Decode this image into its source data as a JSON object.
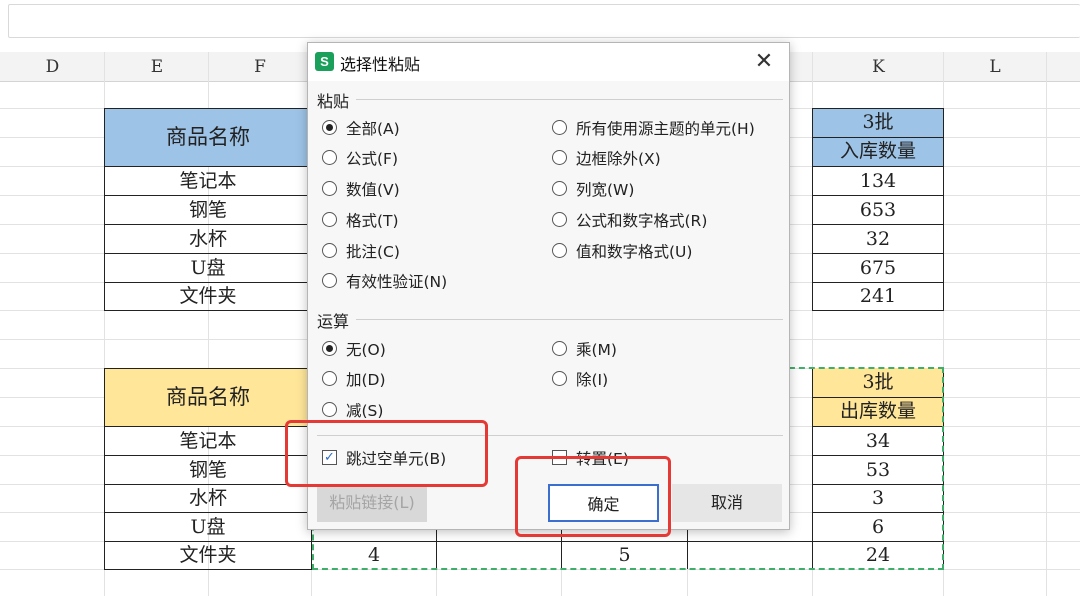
{
  "sheet": {
    "columns": [
      "D",
      "E",
      "F",
      "K",
      "L"
    ],
    "table1": {
      "header_name": "商品名称",
      "header_batch": "3批",
      "header_qty": "入库数量",
      "items": [
        "笔记本",
        "钢笔",
        "水杯",
        "U盘",
        "文件夹"
      ],
      "k_values": [
        "134",
        "653",
        "32",
        "675",
        "241"
      ]
    },
    "table2": {
      "header_name": "商品名称",
      "header_batch": "3批",
      "header_qty": "出库数量",
      "items": [
        "笔记本",
        "钢笔",
        "水杯",
        "U盘",
        "文件夹"
      ],
      "k_values": [
        "34",
        "53",
        "3",
        "6",
        "24"
      ],
      "g_last": "4",
      "i_last": "5"
    }
  },
  "dialog": {
    "icon_label": "S",
    "title": "选择性粘贴",
    "close": "✕",
    "paste_group": "粘贴",
    "paste_options_left": [
      "全部(A)",
      "公式(F)",
      "数值(V)",
      "格式(T)",
      "批注(C)",
      "有效性验证(N)"
    ],
    "paste_options_right": [
      "所有使用源主题的单元(H)",
      "边框除外(X)",
      "列宽(W)",
      "公式和数字格式(R)",
      "值和数字格式(U)"
    ],
    "operation_group": "运算",
    "operation_left": [
      "无(O)",
      "加(D)",
      "减(S)"
    ],
    "operation_right": [
      "乘(M)",
      "除(I)"
    ],
    "skip_blanks": "跳过空单元(B)",
    "skip_blanks_check": "✓",
    "transpose": "转置(E)",
    "paste_link": "粘贴链接(L)",
    "ok": "确定",
    "cancel": "取消"
  }
}
